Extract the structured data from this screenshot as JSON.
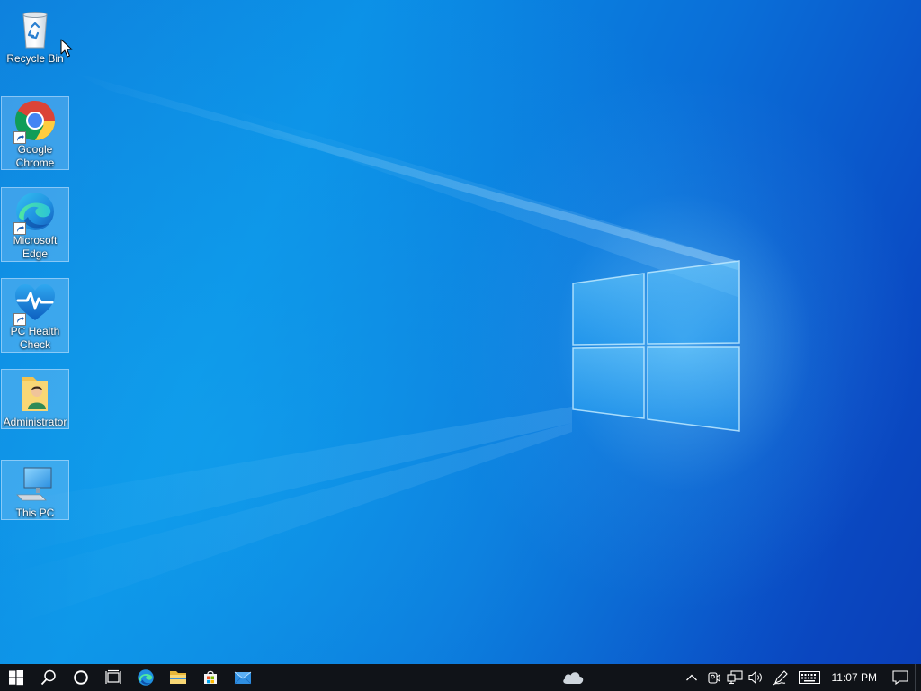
{
  "desktop": {
    "icons": [
      {
        "label": "Recycle Bin"
      },
      {
        "label": "Google Chrome"
      },
      {
        "label": "Microsoft Edge"
      },
      {
        "label": "PC Health Check"
      },
      {
        "label": "Administrator"
      },
      {
        "label": "This PC"
      }
    ]
  },
  "taskbar": {
    "pinned": [
      "start-icon",
      "search-icon",
      "cortana-icon",
      "task-view-icon",
      "edge-icon",
      "file-explorer-icon",
      "microsoft-store-icon",
      "mail-icon"
    ],
    "weather_icon": "cloud-icon",
    "tray": [
      "show-hidden-icons-chevron",
      "meet-now-icon",
      "network-icon",
      "volume-icon",
      "pen-icon",
      "touch-keyboard-icon"
    ],
    "clock": "11:07 PM",
    "notification_icon": "action-center-icon"
  },
  "colors": {
    "taskbar_bg": "#101318",
    "desktop_blue": "#0a78dc",
    "selection": "#b4dcff"
  }
}
